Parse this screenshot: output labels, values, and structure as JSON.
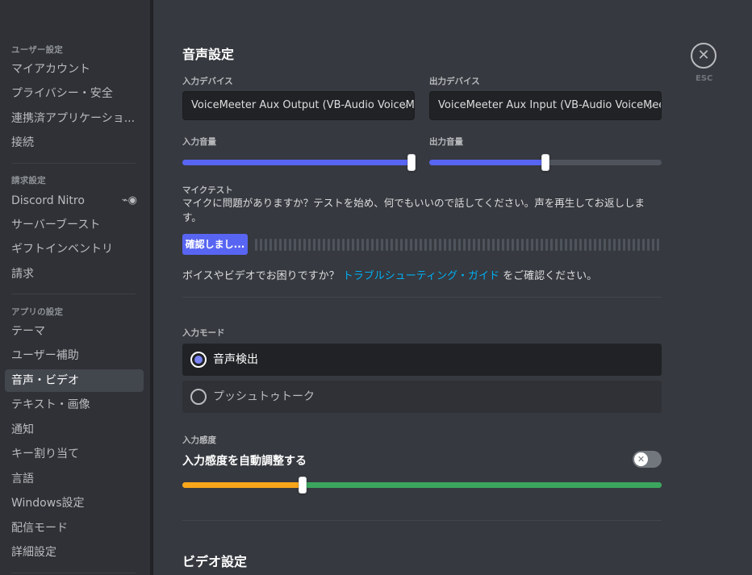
{
  "sidebar": {
    "sections": [
      {
        "header": "ユーザー設定",
        "items": [
          "マイアカウント",
          "プライバシー・安全",
          "連携済アプリケーショ...",
          "接続"
        ]
      },
      {
        "header": "請求設定",
        "items": [
          "Discord Nitro",
          "サーバーブースト",
          "ギフトインベントリ",
          "請求"
        ]
      },
      {
        "header": "アプリの設定",
        "items": [
          "テーマ",
          "ユーザー補助",
          "音声・ビデオ",
          "テキスト・画像",
          "通知",
          "キー割り当て",
          "言語",
          "Windows設定",
          "配信モード",
          "詳細設定"
        ]
      }
    ],
    "selected": "音声・ビデオ",
    "nitro_icon": "nitro-icon"
  },
  "voice": {
    "title": "音声設定",
    "input_device_label": "入力デバイス",
    "input_device_value": "VoiceMeeter Aux Output (VB-Audio VoiceMeeter AUX VAIO)",
    "output_device_label": "出力デバイス",
    "output_device_value": "VoiceMeeter Aux Input (VB-Audio VoiceMeeter AUX VAIO)",
    "input_volume_label": "入力音量",
    "input_volume": 1.0,
    "output_volume_label": "出力音量",
    "output_volume": 0.5,
    "mic_test_label": "マイクテスト",
    "mic_test_desc": "マイクに問題がありますか？テストを始め、何でもいいので話してください。声を再生してお返しします。",
    "mic_test_button": "確認しまし...",
    "help_prefix": "ボイスやビデオでお困りですか？",
    "help_link": "トラブルシューティング・ガイド",
    "help_suffix": "をご確認ください。"
  },
  "input_mode": {
    "label": "入力モード",
    "options": [
      "音声検出",
      "プッシュトゥトーク"
    ],
    "selected": "音声検出"
  },
  "sensitivity": {
    "label": "入力感度",
    "auto_label": "入力感度を自動調整する",
    "auto_enabled": false,
    "threshold": 0.25
  },
  "video": {
    "title": "ビデオ設定"
  },
  "close": {
    "glyph": "✕",
    "label": "ESC"
  }
}
